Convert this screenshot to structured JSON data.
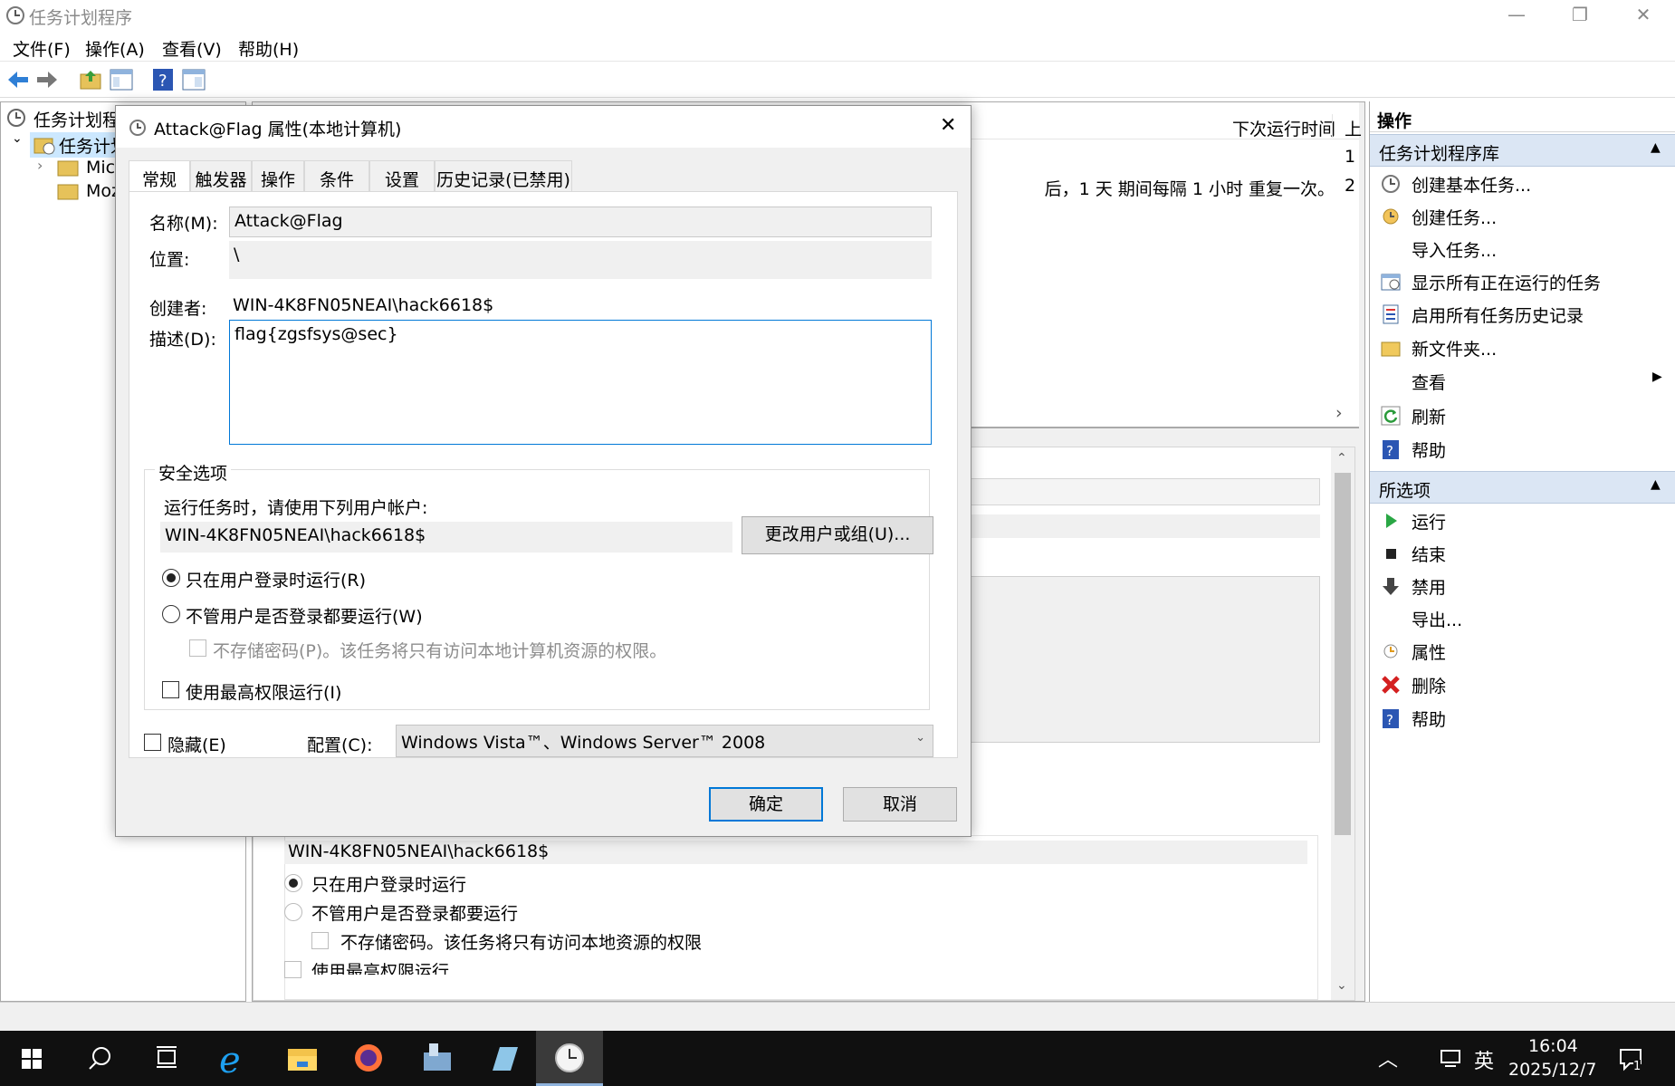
{
  "window": {
    "title": "任务计划程序",
    "menu": [
      "文件(F)",
      "操作(A)",
      "查看(V)",
      "帮助(H)"
    ]
  },
  "tree": {
    "root": "任务计划程",
    "library": "任务计划",
    "children": [
      "Micr",
      "Moz"
    ]
  },
  "center": {
    "col_next_run": "下次运行时间",
    "col_last": "上",
    "row1_last": "1",
    "row2_trigger": "后，1 天 期间每隔 1 小时 重复一次。",
    "row2_last": "2",
    "bg_user": "WIN-4K8FN05NEAI\\hack6618$",
    "bg_radio1": "只在用户登录时运行",
    "bg_radio2": "不管用户是否登录都要运行",
    "bg_check_nopw": "不存储密码。该任务将只有访问本地资源的权限",
    "bg_check_highest": "使用最高权限运行"
  },
  "actions": {
    "header": "操作",
    "section1": "任务计划程序库",
    "items1": [
      "创建基本任务...",
      "创建任务...",
      "导入任务...",
      "显示所有正在运行的任务",
      "启用所有任务历史记录",
      "新文件夹...",
      "查看",
      "刷新",
      "帮助"
    ],
    "section2": "所选项",
    "items2": [
      "运行",
      "结束",
      "禁用",
      "导出...",
      "属性",
      "删除",
      "帮助"
    ]
  },
  "dialog": {
    "title": "Attack@Flag 属性(本地计算机)",
    "tabs": [
      "常规",
      "触发器",
      "操作",
      "条件",
      "设置",
      "历史记录(已禁用)"
    ],
    "name_label": "名称(M):",
    "name_value": "Attack@Flag",
    "location_label": "位置:",
    "location_value": "\\",
    "author_label": "创建者:",
    "author_value": "WIN-4K8FN05NEAI\\hack6618$",
    "desc_label": "描述(D):",
    "desc_value": "flag{zgsfsys@sec}",
    "security_group": "安全选项",
    "run_as_prompt": "运行任务时，请使用下列用户帐户:",
    "run_as_user": "WIN-4K8FN05NEAI\\hack6618$",
    "change_user_button": "更改用户或组(U)...",
    "radio_logged_on": "只在用户登录时运行(R)",
    "radio_whether": "不管用户是否登录都要运行(W)",
    "check_no_password": "不存储密码(P)。该任务将只有访问本地计算机资源的权限。",
    "check_highest": "使用最高权限运行(I)",
    "check_hidden": "隐藏(E)",
    "config_label": "配置(C):",
    "config_value": "Windows Vista™、Windows Server™ 2008",
    "ok_button": "确定",
    "cancel_button": "取消"
  },
  "taskbar": {
    "time": "16:04",
    "date": "2025/12/7",
    "ime": "英",
    "notification_count": "1"
  },
  "colors": {
    "accent": "#0078d7",
    "section_header_bg": "#dbe6f4",
    "taskbar_bg": "#101010"
  }
}
